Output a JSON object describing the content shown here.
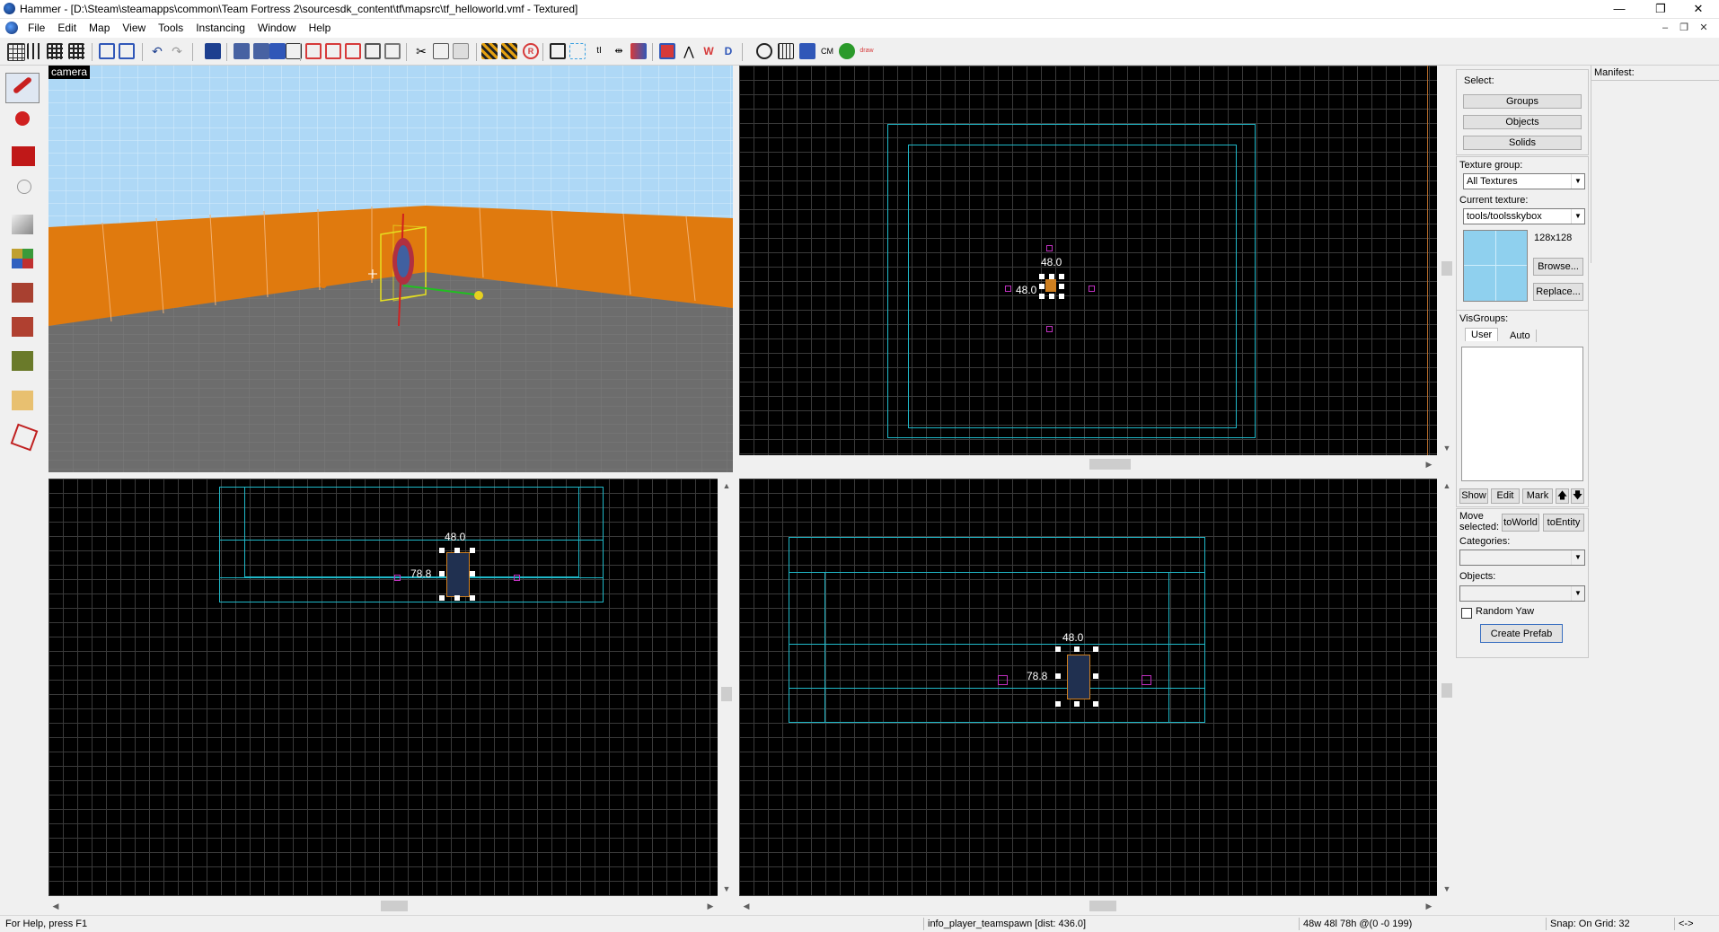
{
  "window": {
    "title": "Hammer - [D:\\Steam\\steamapps\\common\\Team Fortress 2\\sourcesdk_content\\tf\\mapsrc\\tf_helloworld.vmf - Textured]",
    "buttons": {
      "minimize": "—",
      "restore": "❐",
      "close": "✕"
    },
    "mdi_buttons": {
      "minimize": "–",
      "restore": "❐",
      "close": "✕"
    }
  },
  "menu": [
    "File",
    "Edit",
    "Map",
    "View",
    "Tools",
    "Instancing",
    "Window",
    "Help"
  ],
  "viewports": {
    "camera": {
      "label": "camera"
    },
    "top": {
      "dim_w": "48.0",
      "dim_h": "48.0"
    },
    "front": {
      "dim_w": "48.0",
      "dim_h": "78.8"
    },
    "side": {
      "dim_w": "48.0",
      "dim_h": "78.8"
    }
  },
  "toolbar_text": {
    "cm": "CM",
    "draw": "draw"
  },
  "right_panel": {
    "select_label": "Select:",
    "groups_btn": "Groups",
    "objects_btn": "Objects",
    "solids_btn": "Solids",
    "texture_group_label": "Texture group:",
    "texture_group_value": "All Textures",
    "current_texture_label": "Current texture:",
    "current_texture_value": "tools/toolsskybox",
    "texture_size": "128x128",
    "browse_btn": "Browse...",
    "replace_btn": "Replace...",
    "visgroups_label": "VisGroups:",
    "tab_user": "User",
    "tab_auto": "Auto",
    "show_btn": "Show",
    "edit_btn": "Edit",
    "mark_btn": "Mark",
    "up_btn": "🡅",
    "down_btn": "🡇",
    "move_selected_label": "Move selected:",
    "to_world_btn": "toWorld",
    "to_entity_btn": "toEntity",
    "categories_label": "Categories:",
    "objects_label": "Objects:",
    "random_yaw_label": "Random Yaw",
    "create_prefab_btn": "Create Prefab"
  },
  "manifest": {
    "label": "Manifest:"
  },
  "status": {
    "help": "For Help, press F1",
    "entity": "info_player_teamspawn   [dist: 436.0]",
    "size": "48w 48l 78h @(0 -0 199)",
    "snap": "Snap: On Grid: 32",
    "arrows": "<->"
  },
  "colors": {
    "grid_major": "#1c5f6b",
    "grid_minor": "#3a3a3a",
    "brush": "#1fb8c8",
    "accent_orange": "#e07a0e",
    "sky": "#a9d6f5"
  }
}
